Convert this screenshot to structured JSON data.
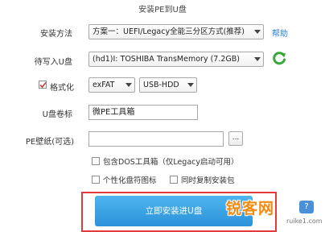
{
  "window": {
    "title": "安装PE到U盘"
  },
  "install_method": {
    "label": "安装方法",
    "selected": "方案一：UEFI/Legacy全能三分区方式(推荐)",
    "help": "帮助"
  },
  "target_drive": {
    "label": "待写入U盘",
    "selected": "(hd1)I: TOSHIBA TransMemory (7.2GB)"
  },
  "format": {
    "label": "格式化",
    "checked": true,
    "filesystem": "exFAT",
    "mode": "USB-HDD"
  },
  "volume_label": {
    "label": "U盘卷标",
    "value": "微PE工具箱"
  },
  "wallpaper": {
    "label": "PE壁纸(可选)",
    "value": "",
    "browse_label": "..."
  },
  "options": {
    "dos_toolbox": "包含DOS工具箱（仅Legacy启动可用）",
    "personalize_icon": "个性化盘符图标",
    "copy_installer": "同时复制安装包"
  },
  "install_button": {
    "label": "立即安装进U盘"
  },
  "watermark": {
    "text": "锐客网",
    "badge": "?",
    "sub": "ruike1.com"
  },
  "colors": {
    "accent": "#2a93d9",
    "frame": "#e33a3a",
    "link": "#2a7fd4",
    "refresh": "#3aa63a"
  }
}
